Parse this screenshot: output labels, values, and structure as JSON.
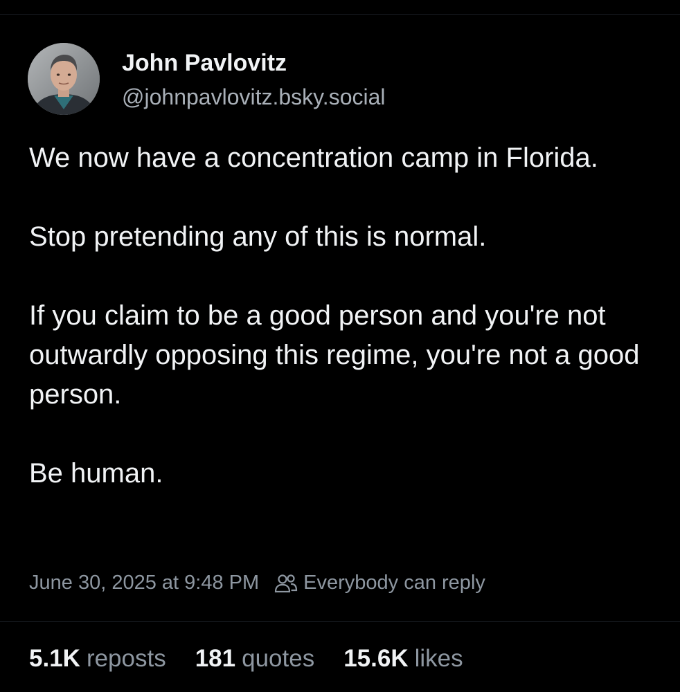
{
  "author": {
    "display_name": "John Pavlovitz",
    "handle": "@johnpavlovitz.bsky.social"
  },
  "post": {
    "paragraphs": [
      "We now have a concentration camp in Florida.",
      "Stop pretending any of this is normal.",
      "If you claim to be a good person and you're not outwardly opposing this regime, you're not a good person.",
      "Be human."
    ],
    "timestamp": "June 30, 2025 at 9:48 PM",
    "reply_setting": "Everybody can reply",
    "reply_icon": "people-icon"
  },
  "stats": [
    {
      "count": "5.1K",
      "label": "reposts"
    },
    {
      "count": "181",
      "label": "quotes"
    },
    {
      "count": "15.6K",
      "label": "likes"
    }
  ],
  "colors": {
    "background": "#000000",
    "primary_text": "#f1f3f5",
    "secondary_text": "#8e97a1",
    "divider": "#1c2026"
  }
}
